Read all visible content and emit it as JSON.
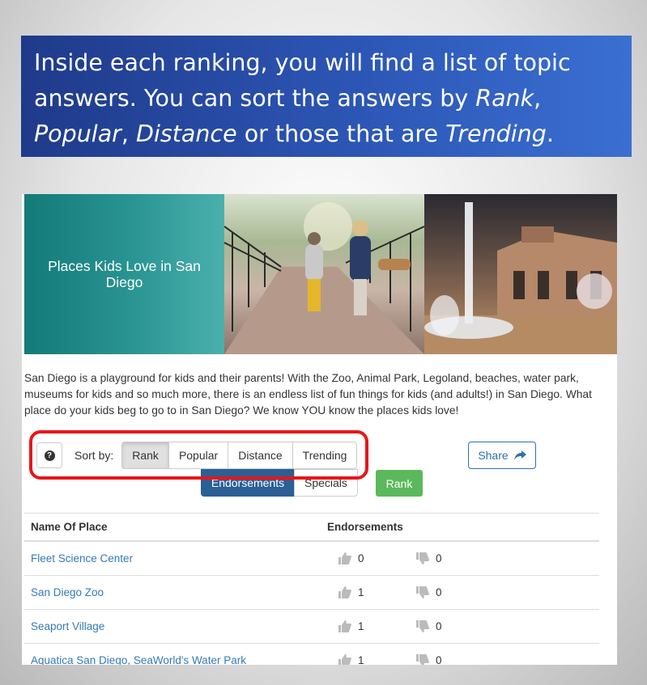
{
  "callout": {
    "seg1": "Inside each ranking, you will find a list of topic answers. You can sort the answers by ",
    "rank": "Rank",
    "seg2": ", ",
    "popular": "Popular",
    "seg3": ", ",
    "distance": "Distance",
    "seg4": " or those that are ",
    "trending": "Trending",
    "seg5": "."
  },
  "banner": {
    "title": "Places Kids Love in San Diego"
  },
  "description": "San Diego is a playground for kids and their parents! With the Zoo, Animal Park, Legoland, beaches, water park, museums for kids and so much more, there is an endless list of fun things for kids (and adults!) in San Diego. What place do your kids beg to go to in San Diego? We know YOU know the places kids love!",
  "sort": {
    "help_glyph": "?",
    "label": "Sort by:",
    "options": [
      "Rank",
      "Popular",
      "Distance",
      "Trending"
    ],
    "selected": "Rank"
  },
  "share": {
    "label": "Share",
    "icon": "share-arrow-icon"
  },
  "tabs": [
    "Endorsements",
    "Specials"
  ],
  "rank_button": "Rank",
  "table": {
    "headers": [
      "Name Of Place",
      "Endorsements"
    ],
    "rows": [
      {
        "name": "Fleet Science Center",
        "up": "0",
        "down": "0"
      },
      {
        "name": "San Diego Zoo",
        "up": "1",
        "down": "0"
      },
      {
        "name": "Seaport Village",
        "up": "1",
        "down": "0"
      },
      {
        "name": "Aquatica San Diego, SeaWorld's Water Park",
        "up": "1",
        "down": "0"
      }
    ]
  },
  "colors": {
    "callout_bg": "#2c56b5",
    "highlight": "#e8161a",
    "link": "#337ab7",
    "active_tab": "#2b5f95",
    "rank_green": "#5cb85c"
  }
}
